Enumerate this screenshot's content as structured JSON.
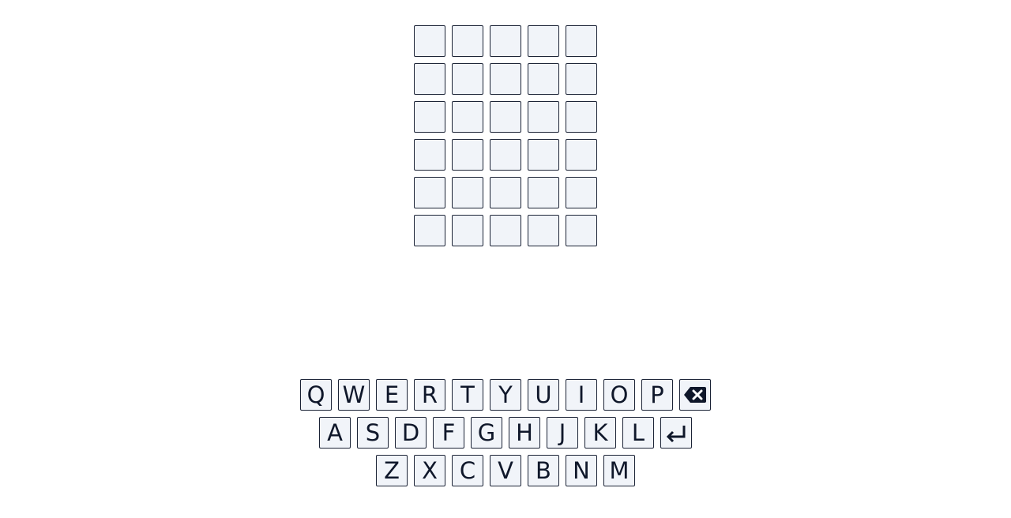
{
  "board": {
    "rows": [
      [
        "",
        "",
        "",
        "",
        ""
      ],
      [
        "",
        "",
        "",
        "",
        ""
      ],
      [
        "",
        "",
        "",
        "",
        ""
      ],
      [
        "",
        "",
        "",
        "",
        ""
      ],
      [
        "",
        "",
        "",
        "",
        ""
      ],
      [
        "",
        "",
        "",
        "",
        ""
      ]
    ]
  },
  "keyboard": {
    "row1": [
      "Q",
      "W",
      "E",
      "R",
      "T",
      "Y",
      "U",
      "I",
      "O",
      "P"
    ],
    "row2": [
      "A",
      "S",
      "D",
      "F",
      "G",
      "H",
      "J",
      "K",
      "L"
    ],
    "row3": [
      "Z",
      "X",
      "C",
      "V",
      "B",
      "N",
      "M"
    ],
    "backspace_icon": "backspace-icon",
    "enter_icon": "enter-icon"
  },
  "colors": {
    "tile_bg": "#f1f4f9",
    "tile_border": "#1b2336",
    "text": "#0f172a"
  }
}
